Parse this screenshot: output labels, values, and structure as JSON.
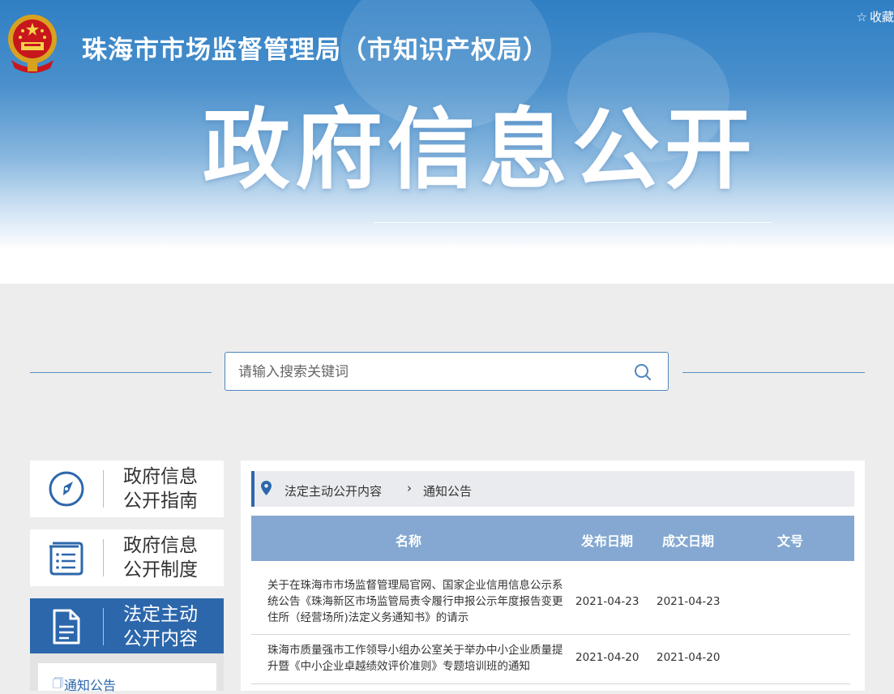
{
  "header": {
    "site_title": "珠海市市场监督管理局（市知识产权局）",
    "favorite_label": "收藏",
    "banner_title": "政府信息公开"
  },
  "search": {
    "placeholder": "请输入搜索关键词"
  },
  "sidebar": {
    "items": [
      {
        "line1": "政府信息",
        "line2": "公开指南",
        "icon": "compass-icon",
        "active": false
      },
      {
        "line1": "政府信息",
        "line2": "公开制度",
        "icon": "list-icon",
        "active": false
      },
      {
        "line1": "法定主动",
        "line2": "公开内容",
        "icon": "document-icon",
        "active": true
      }
    ],
    "sub_items": [
      {
        "label": "通知公告"
      }
    ]
  },
  "breadcrumb": {
    "level1": "法定主动公开内容",
    "level2": "通知公告"
  },
  "table": {
    "headers": {
      "name": "名称",
      "publish_date": "发布日期",
      "created_date": "成文日期",
      "doc_no": "文号"
    },
    "rows": [
      {
        "name": "关于在珠海市市场监督管理局官网、国家企业信用信息公示系统公告《珠海新区市场监管局责令履行申报公示年度报告变更住所（经营场所)法定义务通知书》的请示",
        "publish_date": "2021-04-23",
        "created_date": "2021-04-23",
        "doc_no": ""
      },
      {
        "name": "珠海市质量强市工作领导小组办公室关于举办中小企业质量提升暨《中小企业卓越绩效评价准则》专题培训班的通知",
        "publish_date": "2021-04-20",
        "created_date": "2021-04-20",
        "doc_no": ""
      }
    ]
  },
  "colors": {
    "accent": "#2c67ac",
    "table_header": "#84a8d1",
    "banner_blue": "#2f7fc4"
  }
}
